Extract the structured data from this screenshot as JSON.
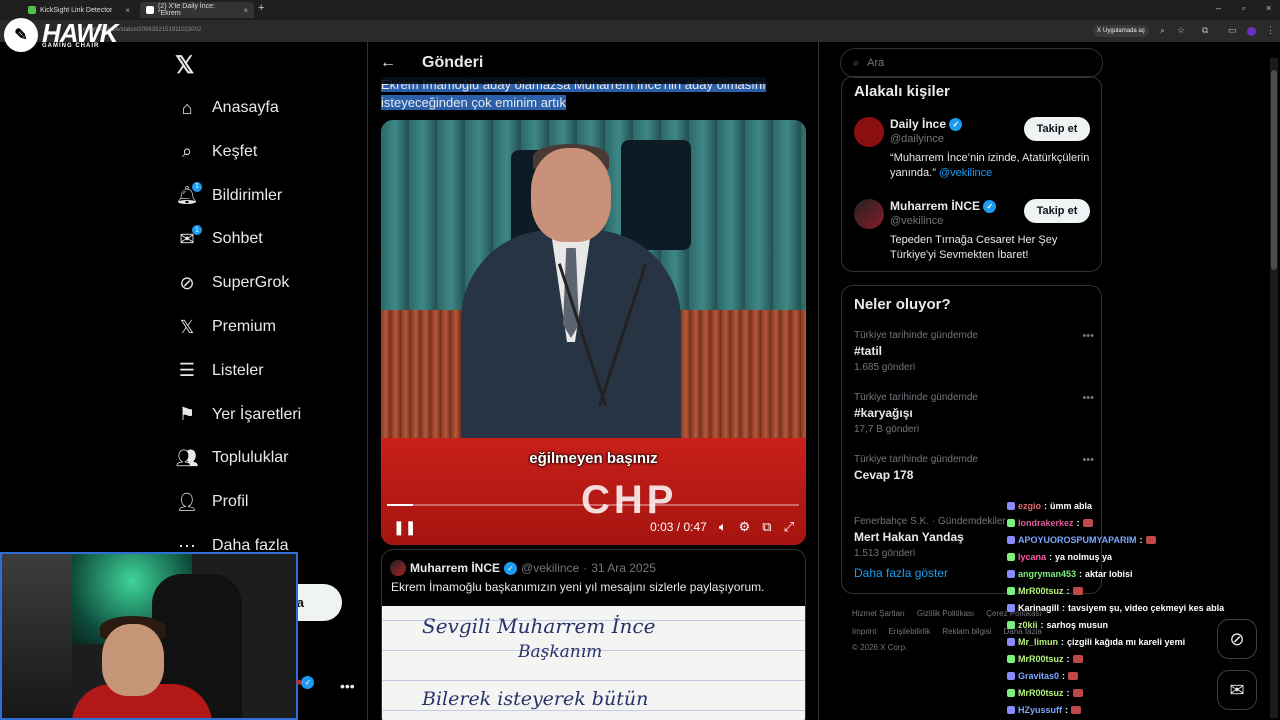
{
  "browser": {
    "tabs": [
      {
        "label": "KickSight Link Detector",
        "color": "#53c04b"
      },
      {
        "label": "(2) X'te Daily İnce: \"Ekrem",
        "color": "#ffffff"
      }
    ],
    "url": "x.com/dailyince/status/2006332151911023002",
    "app_chip": "Uygulamada aç",
    "new_tab": "+"
  },
  "logo": {
    "brand": "HAWK",
    "sub": "GAMING CHAIR"
  },
  "nav": {
    "items": [
      {
        "label": "Anasayfa",
        "icon": "home-icon"
      },
      {
        "label": "Keşfet",
        "icon": "search-icon"
      },
      {
        "label": "Bildirimler",
        "icon": "bell-icon",
        "badge": "1"
      },
      {
        "label": "Sohbet",
        "icon": "envelope-icon",
        "badge": "1"
      },
      {
        "label": "SuperGrok",
        "icon": "grok-icon"
      },
      {
        "label": "Premium",
        "icon": "x-icon"
      },
      {
        "label": "Listeler",
        "icon": "list-icon"
      },
      {
        "label": "Yer İşaretleri",
        "icon": "bookmark-icon"
      },
      {
        "label": "Topluluklar",
        "icon": "people-icon"
      },
      {
        "label": "Profil",
        "icon": "person-icon"
      },
      {
        "label": "Daha fazla",
        "icon": "more-circle-icon"
      }
    ],
    "post_button_label": "a"
  },
  "main": {
    "title": "Gönderi",
    "tweet_text_before": "Ekrem İmamoğlu aday olamazsa Muharrem İnce'nin aday olmasını",
    "tweet_text_line2": "isteyeceğinden çok eminim artık",
    "video": {
      "caption": "eğilmeyen başınız",
      "banner_text": "CHP",
      "time": "0:03 / 0:47",
      "progress": 0.064
    },
    "quote": {
      "name": "Muharrem İNCE",
      "handle": "@vekilince",
      "date": "31 Ara 2025",
      "text": "Ekrem İmamoğlu başkanımızın yeni yıl mesajını sizlerle paylaşıyorum.",
      "letter_lines": [
        "Sevgili Muharrem İnce",
        "Başkanım",
        "Bilerek isteyerek bütün"
      ]
    }
  },
  "right": {
    "search_placeholder": "Ara",
    "related_title": "Alakalı kişiler",
    "people": [
      {
        "name": "Daily İnce",
        "handle": "@dailyince",
        "bio": "“Muharrem İnce’nin izinde, Atatürkçülerin yanında.”",
        "bio_link": "@vekilince",
        "follow": "Takip et"
      },
      {
        "name": "Muharrem İNCE",
        "handle": "@vekilince",
        "bio": "Tepeden Tırnağa Cesaret Her Şey Türkiye'yi Sevmekten İbaret!",
        "follow": "Takip et"
      }
    ],
    "trends_title": "Neler oluyor?",
    "trends": [
      {
        "context": "Türkiye tarihinde gündemde",
        "title": "#tatil",
        "count": "1.685 gönderi"
      },
      {
        "context": "Türkiye tarihinde gündemde",
        "title": "#karyağışı",
        "count": "17,7 B gönderi"
      },
      {
        "context": "Türkiye tarihinde gündemde",
        "title": "Cevap 178",
        "count": ""
      },
      {
        "context": "Fenerbahçe S.K. · Gündemdekiler",
        "title": "Mert Hakan Yandaş",
        "count": "1.513 gönderi"
      }
    ],
    "show_more": "Daha fazla göster",
    "footer_row1": [
      "Hizmet Şartları",
      "Gizlilik Politikası",
      "Çerez Politikası"
    ],
    "footer_row2": [
      "Imprint",
      "Erişilebilirlik",
      "Reklam bilgisi",
      "Daha fazla"
    ],
    "copyright": "© 2026 X Corp."
  },
  "chat": [
    {
      "user": "ezgio",
      "msg": "ümm abla",
      "color": "#e06c6c"
    },
    {
      "user": "londrakerkez",
      "msg": "",
      "color": "#e05a9b"
    },
    {
      "user": "APOYUOROSPUMYAPARIM",
      "msg": "",
      "color": "#7aa7ff"
    },
    {
      "user": "lycana",
      "msg": "ya nolmuş ya",
      "color": "#ff5ca8"
    },
    {
      "user": "angryman453",
      "msg": "aktar lobisi",
      "color": "#7cf07c"
    },
    {
      "user": "MrR00tsuz",
      "msg": "",
      "color": "#b5f07c"
    },
    {
      "user": "Karinagill",
      "msg": "tavsiyem şu, video çekmeyi kes abla",
      "color": "#ffffff"
    },
    {
      "user": "z0kii",
      "msg": "sarhoş musun",
      "color": "#b5f07c"
    },
    {
      "user": "Mr_limun",
      "msg": "çizgili kağıda mı kareli yemi",
      "color": "#b5f07c"
    },
    {
      "user": "MrR00tsuz",
      "msg": "",
      "color": "#b5f07c"
    },
    {
      "user": "Gravitas0",
      "msg": "",
      "color": "#7aa7ff"
    },
    {
      "user": "MrR00tsuz",
      "msg": "",
      "color": "#b5f07c"
    },
    {
      "user": "HZyussuff",
      "msg": "",
      "color": "#7aa7ff"
    }
  ],
  "colors": {
    "accent": "#1d9bf0",
    "background": "#000000",
    "border": "#2f3336"
  }
}
